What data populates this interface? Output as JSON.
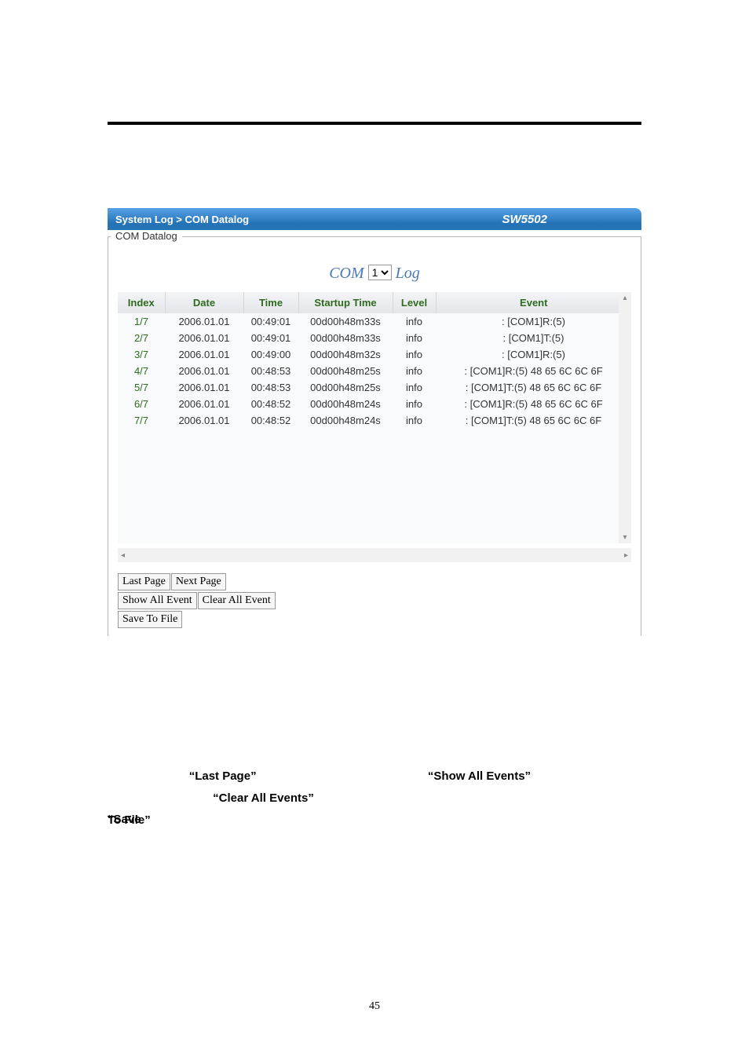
{
  "titlebar": {
    "breadcrumb": "System Log > COM Datalog",
    "model": "SW5502"
  },
  "group_label": "COM Datalog",
  "com_select": {
    "prefix": "COM ",
    "value": "1",
    "suffix": " Log"
  },
  "columns": {
    "index": "Index",
    "date": "Date",
    "time": "Time",
    "startup": "Startup Time",
    "level": "Level",
    "event": "Event"
  },
  "rows": [
    {
      "index": "1/7",
      "date": "2006.01.01",
      "time": "00:49:01",
      "startup": "00d00h48m33s",
      "level": "info",
      "event": ": [COM1]R:(5)"
    },
    {
      "index": "2/7",
      "date": "2006.01.01",
      "time": "00:49:01",
      "startup": "00d00h48m33s",
      "level": "info",
      "event": ": [COM1]T:(5)"
    },
    {
      "index": "3/7",
      "date": "2006.01.01",
      "time": "00:49:00",
      "startup": "00d00h48m32s",
      "level": "info",
      "event": ": [COM1]R:(5)"
    },
    {
      "index": "4/7",
      "date": "2006.01.01",
      "time": "00:48:53",
      "startup": "00d00h48m25s",
      "level": "info",
      "event": ": [COM1]R:(5) 48 65 6C 6C 6F"
    },
    {
      "index": "5/7",
      "date": "2006.01.01",
      "time": "00:48:53",
      "startup": "00d00h48m25s",
      "level": "info",
      "event": ": [COM1]T:(5) 48 65 6C 6C 6F"
    },
    {
      "index": "6/7",
      "date": "2006.01.01",
      "time": "00:48:52",
      "startup": "00d00h48m24s",
      "level": "info",
      "event": ": [COM1]R:(5) 48 65 6C 6C 6F"
    },
    {
      "index": "7/7",
      "date": "2006.01.01",
      "time": "00:48:52",
      "startup": "00d00h48m24s",
      "level": "info",
      "event": ": [COM1]T:(5) 48 65 6C 6C 6F"
    }
  ],
  "buttons": {
    "last_page": "Last Page",
    "next_page": "Next Page",
    "show_all": "Show All Event",
    "clear_all": "Clear All Event",
    "save_to_file": "Save To File"
  },
  "body": {
    "q_last_page": "“Last Page”",
    "q_show_all": "“Show All Events”",
    "q_clear_all": "“Clear All Events”",
    "q_save_to_file_1": "“Save",
    "q_save_to_file_2": "To File”"
  },
  "page_number": "45"
}
